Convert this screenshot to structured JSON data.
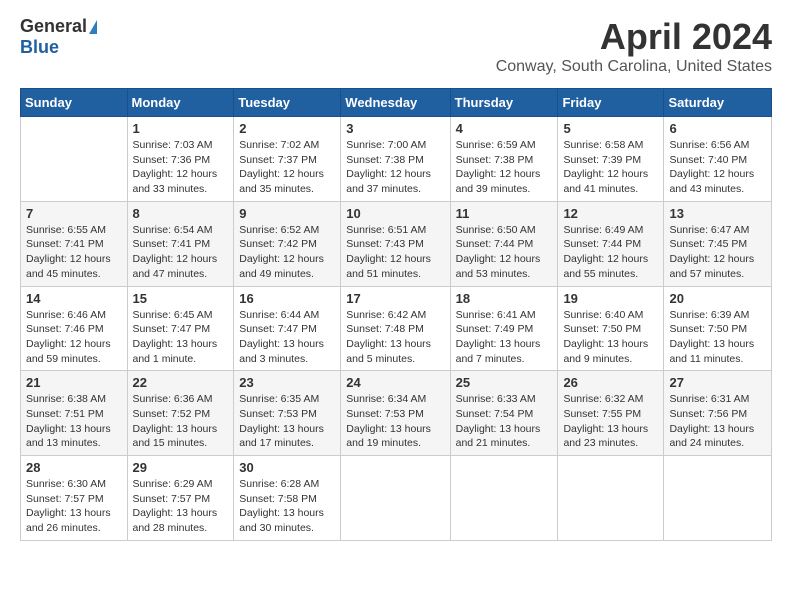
{
  "logo": {
    "general": "General",
    "blue": "Blue"
  },
  "title": "April 2024",
  "location": "Conway, South Carolina, United States",
  "days_of_week": [
    "Sunday",
    "Monday",
    "Tuesday",
    "Wednesday",
    "Thursday",
    "Friday",
    "Saturday"
  ],
  "weeks": [
    [
      {
        "day": "",
        "info": ""
      },
      {
        "day": "1",
        "info": "Sunrise: 7:03 AM\nSunset: 7:36 PM\nDaylight: 12 hours\nand 33 minutes."
      },
      {
        "day": "2",
        "info": "Sunrise: 7:02 AM\nSunset: 7:37 PM\nDaylight: 12 hours\nand 35 minutes."
      },
      {
        "day": "3",
        "info": "Sunrise: 7:00 AM\nSunset: 7:38 PM\nDaylight: 12 hours\nand 37 minutes."
      },
      {
        "day": "4",
        "info": "Sunrise: 6:59 AM\nSunset: 7:38 PM\nDaylight: 12 hours\nand 39 minutes."
      },
      {
        "day": "5",
        "info": "Sunrise: 6:58 AM\nSunset: 7:39 PM\nDaylight: 12 hours\nand 41 minutes."
      },
      {
        "day": "6",
        "info": "Sunrise: 6:56 AM\nSunset: 7:40 PM\nDaylight: 12 hours\nand 43 minutes."
      }
    ],
    [
      {
        "day": "7",
        "info": "Sunrise: 6:55 AM\nSunset: 7:41 PM\nDaylight: 12 hours\nand 45 minutes."
      },
      {
        "day": "8",
        "info": "Sunrise: 6:54 AM\nSunset: 7:41 PM\nDaylight: 12 hours\nand 47 minutes."
      },
      {
        "day": "9",
        "info": "Sunrise: 6:52 AM\nSunset: 7:42 PM\nDaylight: 12 hours\nand 49 minutes."
      },
      {
        "day": "10",
        "info": "Sunrise: 6:51 AM\nSunset: 7:43 PM\nDaylight: 12 hours\nand 51 minutes."
      },
      {
        "day": "11",
        "info": "Sunrise: 6:50 AM\nSunset: 7:44 PM\nDaylight: 12 hours\nand 53 minutes."
      },
      {
        "day": "12",
        "info": "Sunrise: 6:49 AM\nSunset: 7:44 PM\nDaylight: 12 hours\nand 55 minutes."
      },
      {
        "day": "13",
        "info": "Sunrise: 6:47 AM\nSunset: 7:45 PM\nDaylight: 12 hours\nand 57 minutes."
      }
    ],
    [
      {
        "day": "14",
        "info": "Sunrise: 6:46 AM\nSunset: 7:46 PM\nDaylight: 12 hours\nand 59 minutes."
      },
      {
        "day": "15",
        "info": "Sunrise: 6:45 AM\nSunset: 7:47 PM\nDaylight: 13 hours\nand 1 minute."
      },
      {
        "day": "16",
        "info": "Sunrise: 6:44 AM\nSunset: 7:47 PM\nDaylight: 13 hours\nand 3 minutes."
      },
      {
        "day": "17",
        "info": "Sunrise: 6:42 AM\nSunset: 7:48 PM\nDaylight: 13 hours\nand 5 minutes."
      },
      {
        "day": "18",
        "info": "Sunrise: 6:41 AM\nSunset: 7:49 PM\nDaylight: 13 hours\nand 7 minutes."
      },
      {
        "day": "19",
        "info": "Sunrise: 6:40 AM\nSunset: 7:50 PM\nDaylight: 13 hours\nand 9 minutes."
      },
      {
        "day": "20",
        "info": "Sunrise: 6:39 AM\nSunset: 7:50 PM\nDaylight: 13 hours\nand 11 minutes."
      }
    ],
    [
      {
        "day": "21",
        "info": "Sunrise: 6:38 AM\nSunset: 7:51 PM\nDaylight: 13 hours\nand 13 minutes."
      },
      {
        "day": "22",
        "info": "Sunrise: 6:36 AM\nSunset: 7:52 PM\nDaylight: 13 hours\nand 15 minutes."
      },
      {
        "day": "23",
        "info": "Sunrise: 6:35 AM\nSunset: 7:53 PM\nDaylight: 13 hours\nand 17 minutes."
      },
      {
        "day": "24",
        "info": "Sunrise: 6:34 AM\nSunset: 7:53 PM\nDaylight: 13 hours\nand 19 minutes."
      },
      {
        "day": "25",
        "info": "Sunrise: 6:33 AM\nSunset: 7:54 PM\nDaylight: 13 hours\nand 21 minutes."
      },
      {
        "day": "26",
        "info": "Sunrise: 6:32 AM\nSunset: 7:55 PM\nDaylight: 13 hours\nand 23 minutes."
      },
      {
        "day": "27",
        "info": "Sunrise: 6:31 AM\nSunset: 7:56 PM\nDaylight: 13 hours\nand 24 minutes."
      }
    ],
    [
      {
        "day": "28",
        "info": "Sunrise: 6:30 AM\nSunset: 7:57 PM\nDaylight: 13 hours\nand 26 minutes."
      },
      {
        "day": "29",
        "info": "Sunrise: 6:29 AM\nSunset: 7:57 PM\nDaylight: 13 hours\nand 28 minutes."
      },
      {
        "day": "30",
        "info": "Sunrise: 6:28 AM\nSunset: 7:58 PM\nDaylight: 13 hours\nand 30 minutes."
      },
      {
        "day": "",
        "info": ""
      },
      {
        "day": "",
        "info": ""
      },
      {
        "day": "",
        "info": ""
      },
      {
        "day": "",
        "info": ""
      }
    ]
  ]
}
